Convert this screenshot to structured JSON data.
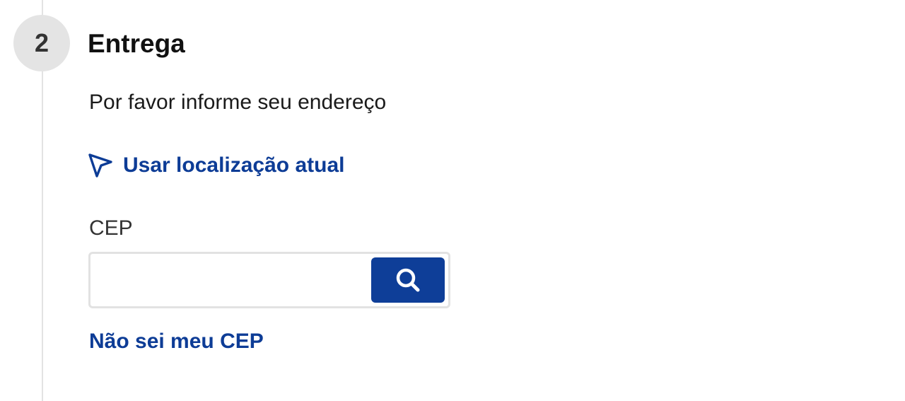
{
  "step": {
    "number": "2",
    "title": "Entrega"
  },
  "delivery": {
    "instructions": "Por favor informe seu endereço",
    "use_location_label": "Usar localização atual",
    "cep_label": "CEP",
    "cep_value": "",
    "cep_placeholder": "",
    "search_icon": "search-icon",
    "location_icon": "navigation-arrow-icon",
    "unknown_cep_link": "Não sei meu CEP"
  },
  "colors": {
    "link": "#0d3c96",
    "button": "#0e3e98",
    "step_circle": "#e4e4e4",
    "border": "#e2e2e2"
  }
}
